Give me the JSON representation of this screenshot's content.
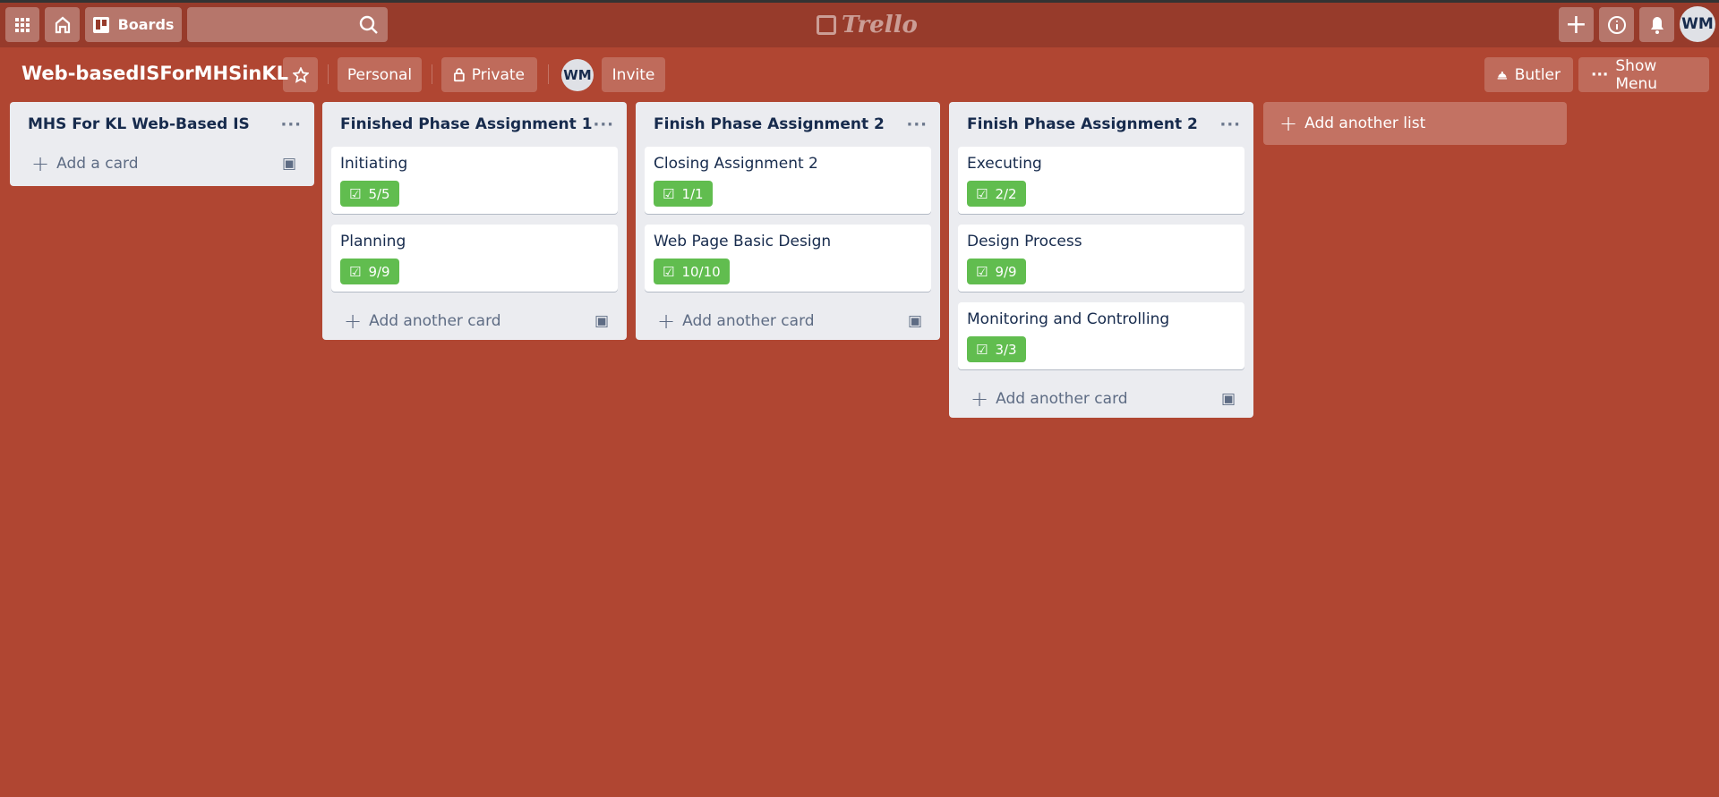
{
  "topbar": {
    "boards_label": "Boards",
    "search_placeholder": "",
    "logo_text": "Trello",
    "avatar": "WM"
  },
  "board": {
    "title": "Web-basedISForMHSinKL",
    "visibility_team": "Personal",
    "privacy": "Private",
    "member_avatar": "WM",
    "invite": "Invite",
    "butler": "Butler",
    "show_menu": "Show Menu"
  },
  "lists": [
    {
      "title": "MHS For KL Web-Based IS",
      "cards": [],
      "add_label": "Add a card"
    },
    {
      "title": "Finished Phase Assignment 1",
      "cards": [
        {
          "title": "Initiating",
          "checklist": "5/5"
        },
        {
          "title": "Planning",
          "checklist": "9/9"
        }
      ],
      "add_label": "Add another card"
    },
    {
      "title": "Finish Phase Assignment 2",
      "cards": [
        {
          "title": "Closing Assignment 2",
          "checklist": "1/1"
        },
        {
          "title": "Web Page Basic Design",
          "checklist": "10/10"
        }
      ],
      "add_label": "Add another card"
    },
    {
      "title": "Finish Phase Assignment 2",
      "cards": [
        {
          "title": "Executing",
          "checklist": "2/2"
        },
        {
          "title": "Design Process",
          "checklist": "9/9"
        },
        {
          "title": "Monitoring and Controlling",
          "checklist": "3/3"
        }
      ],
      "add_label": "Add another card"
    }
  ],
  "add_list_label": "Add another list",
  "colors": {
    "background": "#b04632",
    "topbar": "#973b2b",
    "list": "#ebecf0",
    "badge_complete": "#61bd4f"
  }
}
